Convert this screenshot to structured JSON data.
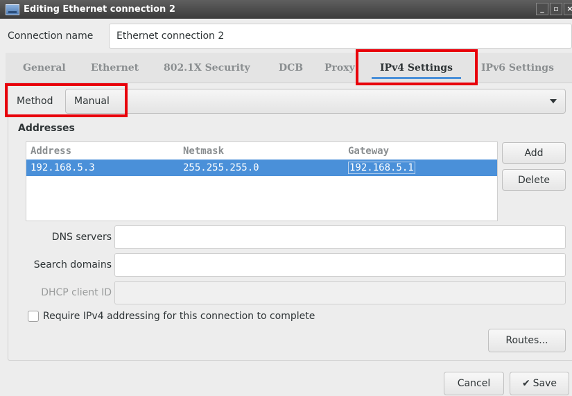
{
  "window": {
    "title": "Editing Ethernet connection 2",
    "app_icon": "network-icon",
    "controls": [
      "_",
      "▫",
      "×"
    ]
  },
  "connection": {
    "label": "Connection name",
    "value": "Ethernet connection 2"
  },
  "tabs": [
    {
      "label": "General",
      "active": false
    },
    {
      "label": "Ethernet",
      "active": false
    },
    {
      "label": "802.1X Security",
      "active": false
    },
    {
      "label": "DCB",
      "active": false
    },
    {
      "label": "Proxy",
      "active": false
    },
    {
      "label": "IPv4 Settings",
      "active": true
    },
    {
      "label": "IPv6 Settings",
      "active": false
    }
  ],
  "method": {
    "label": "Method",
    "value": "Manual"
  },
  "addresses": {
    "heading": "Addresses",
    "columns": [
      "Address",
      "Netmask",
      "Gateway"
    ],
    "rows": [
      {
        "address": "192.168.5.3",
        "netmask": "255.255.255.0",
        "gateway": "192.168.5.1",
        "selected": true
      }
    ],
    "add_label": "Add",
    "delete_label": "Delete"
  },
  "fields": {
    "dns_label": "DNS servers",
    "dns_value": "",
    "search_label": "Search domains",
    "search_value": "",
    "dhcp_label": "DHCP client ID",
    "dhcp_value": ""
  },
  "require_ipv4": {
    "label": "Require IPv4 addressing for this connection to complete",
    "checked": false
  },
  "routes_label": "Routes...",
  "footer": {
    "cancel_label": "Cancel",
    "save_icon": "checkmark-icon",
    "save_label": "Save"
  },
  "colors": {
    "accent": "#4a90d9",
    "highlight_box": "#e8000b",
    "titlebar": "#3b3b3b"
  }
}
